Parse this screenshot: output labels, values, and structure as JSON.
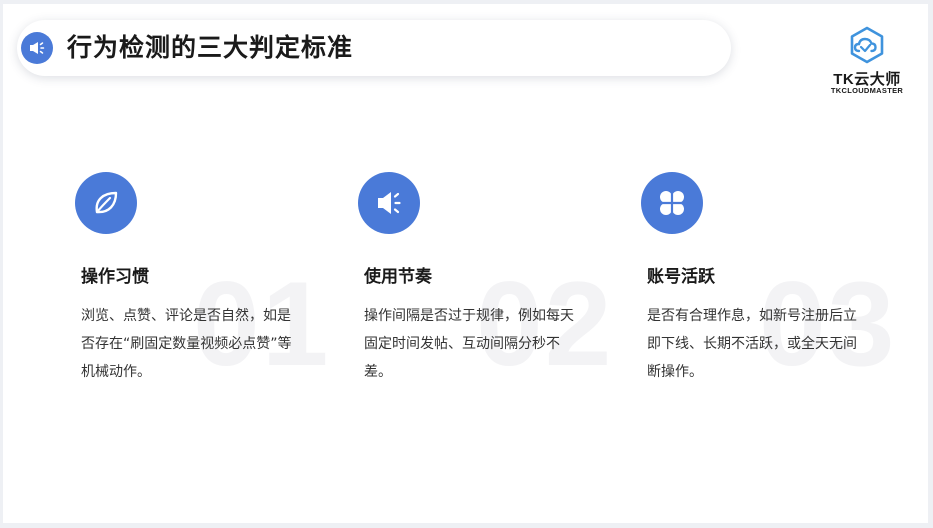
{
  "title": "行为检测的三大判定标准",
  "logo": {
    "name": "TK云大师",
    "subtitle": "TKCLOUDMASTER"
  },
  "items": [
    {
      "number": "01",
      "title": "操作习惯",
      "description": "浏览、点赞、评论是否自然，如是否存在“刷固定数量视频必点赞”等机械动作。",
      "icon": "leaf-icon"
    },
    {
      "number": "02",
      "title": "使用节奏",
      "description": "操作间隔是否过于规律，例如每天固定时间发帖、互动间隔分秒不差。",
      "icon": "megaphone-icon"
    },
    {
      "number": "03",
      "title": "账号活跃",
      "description": "是否有合理作息，如新号注册后立即下线、长期不活跃，或全天无间断操作。",
      "icon": "grid-icon"
    }
  ],
  "colors": {
    "accent": "#4a7ad8",
    "text": "#1a1a1a",
    "watermark": "#f3f3f5"
  }
}
